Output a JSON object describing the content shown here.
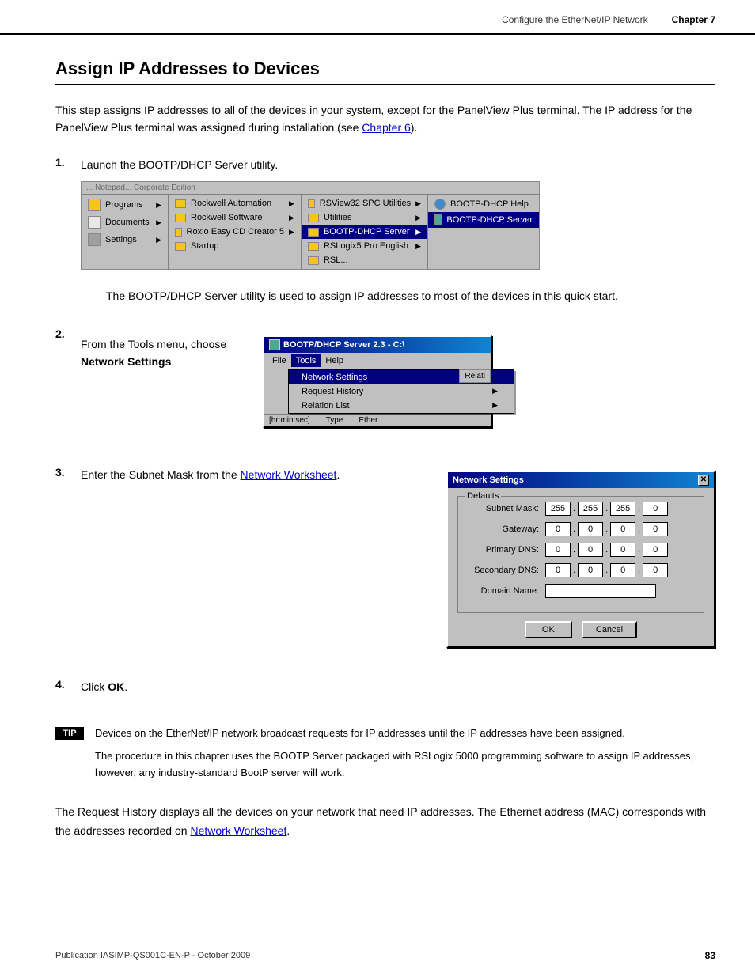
{
  "header": {
    "breadcrumb": "Configure the EtherNet/IP Network",
    "chapter": "Chapter 7"
  },
  "section": {
    "title": "Assign IP Addresses to Devices",
    "intro": "This step assigns IP addresses to all of the devices in your system, except for the PanelView Plus terminal. The IP address for the PanelView Plus terminal was assigned during installation (see ",
    "intro_link": "Chapter 6",
    "intro_end": ")."
  },
  "steps": [
    {
      "number": "1.",
      "text": "Launch the BOOTP/DHCP Server utility.",
      "description": "The BOOTP/DHCP Server utility is used to assign IP addresses to most of the devices in this quick start."
    },
    {
      "number": "2.",
      "text_pre": "From the Tools menu, choose ",
      "text_bold": "Network Settings",
      "text_end": "."
    },
    {
      "number": "3.",
      "text_pre": "Enter the Subnet Mask from the ",
      "text_link": "Network Worksheet",
      "text_end": "."
    },
    {
      "number": "4.",
      "text_pre": "Click ",
      "text_bold": "OK",
      "text_end": "."
    }
  ],
  "win_menu": {
    "title": "Programs",
    "col1": [
      {
        "label": "Programs",
        "icon": "folder",
        "arrow": true,
        "highlighted": false
      },
      {
        "label": "Documents",
        "icon": "docs",
        "arrow": true,
        "highlighted": false
      },
      {
        "label": "Settings",
        "icon": "settings",
        "arrow": true,
        "highlighted": false
      }
    ],
    "col2": [
      {
        "label": "Rockwell Automation",
        "icon": "folder",
        "arrow": true,
        "highlighted": false
      },
      {
        "label": "Rockwell Software",
        "icon": "folder",
        "arrow": true,
        "highlighted": false
      },
      {
        "label": "Roxio Easy CD Creator 5",
        "icon": "folder",
        "arrow": true,
        "highlighted": false
      },
      {
        "label": "Startup",
        "icon": "folder",
        "arrow": false,
        "highlighted": false
      }
    ],
    "col3": [
      {
        "label": "RSView32 SPC Utilities",
        "icon": "folder",
        "arrow": true,
        "highlighted": false
      },
      {
        "label": "Utilities",
        "icon": "folder",
        "arrow": true,
        "highlighted": false
      },
      {
        "label": "BOOTP-DHCP Server",
        "icon": "folder",
        "arrow": true,
        "highlighted": true
      },
      {
        "label": "RSLogix5 Pro English",
        "icon": "folder",
        "arrow": true,
        "highlighted": false
      },
      {
        "label": "RSL...",
        "icon": "folder",
        "arrow": false,
        "highlighted": false
      }
    ],
    "col4": [
      {
        "label": "BOOTP-DHCP Help",
        "icon": "help",
        "highlighted": false
      },
      {
        "label": "BOOTP-DHCP Server",
        "icon": "server",
        "highlighted": true
      }
    ]
  },
  "bootp_window": {
    "title": "BOOTP/DHCP Server 2.3 - C:\\",
    "menus": [
      "File",
      "Tools",
      "Help"
    ],
    "tools_open": true,
    "dropdown_items": [
      {
        "label": "Network Settings",
        "highlighted": true,
        "arrow": false
      },
      {
        "label": "Request History",
        "highlighted": false,
        "arrow": true
      },
      {
        "label": "Relation List",
        "highlighted": false,
        "arrow": true
      }
    ],
    "table_cols": [
      "[hr:min:sec]",
      "Type",
      "Ether"
    ],
    "relati_label": "Relati"
  },
  "network_settings": {
    "title": "Network Settings",
    "group_label": "Defaults",
    "fields": [
      {
        "label": "Subnet Mask:",
        "values": [
          "255",
          "255",
          "255",
          "0"
        ]
      },
      {
        "label": "Gateway:",
        "values": [
          "0",
          "0",
          "0",
          "0"
        ]
      },
      {
        "label": "Primary DNS:",
        "values": [
          "0",
          "0",
          "0",
          "0"
        ]
      },
      {
        "label": "Secondary DNS:",
        "values": [
          "0",
          "0",
          "0",
          "0"
        ]
      }
    ],
    "domain_label": "Domain Name:",
    "ok_label": "OK",
    "cancel_label": "Cancel"
  },
  "tip": {
    "label": "TIP",
    "line1": "Devices on the EtherNet/IP network broadcast requests for IP addresses until the IP addresses have been assigned.",
    "line2": "The procedure in this chapter uses the BOOTP Server packaged with RSLogix 5000 programming software to assign IP addresses, however, any industry-standard BootP server will work."
  },
  "closing": {
    "text": "The Request History displays all the devices on your network that need IP addresses. The Ethernet address (MAC) corresponds with the addresses recorded on ",
    "link": "Network Worksheet",
    "end": "."
  },
  "footer": {
    "publication": "Publication IASIMP-QS001C-EN-P - October 2009",
    "page": "83"
  }
}
